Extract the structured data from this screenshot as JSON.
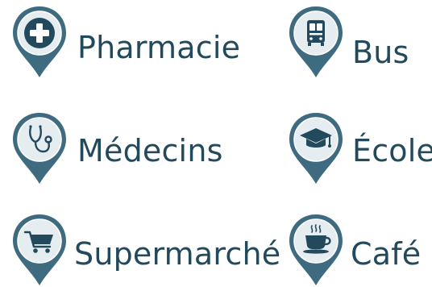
{
  "colors": {
    "pin_fill": "#3f6b80",
    "pin_light": "#e6edf1",
    "icon_color": "#23495c",
    "text_color": "#23495c"
  },
  "items": [
    {
      "label": "Pharmacie",
      "icon": "pharmacy-cross-icon"
    },
    {
      "label": "Bus",
      "icon": "bus-icon"
    },
    {
      "label": "Médecins",
      "icon": "stethoscope-icon"
    },
    {
      "label": "École",
      "icon": "graduation-cap-icon"
    },
    {
      "label": "Supermarché",
      "icon": "shopping-cart-icon"
    },
    {
      "label": "Café",
      "icon": "coffee-cup-icon"
    }
  ]
}
